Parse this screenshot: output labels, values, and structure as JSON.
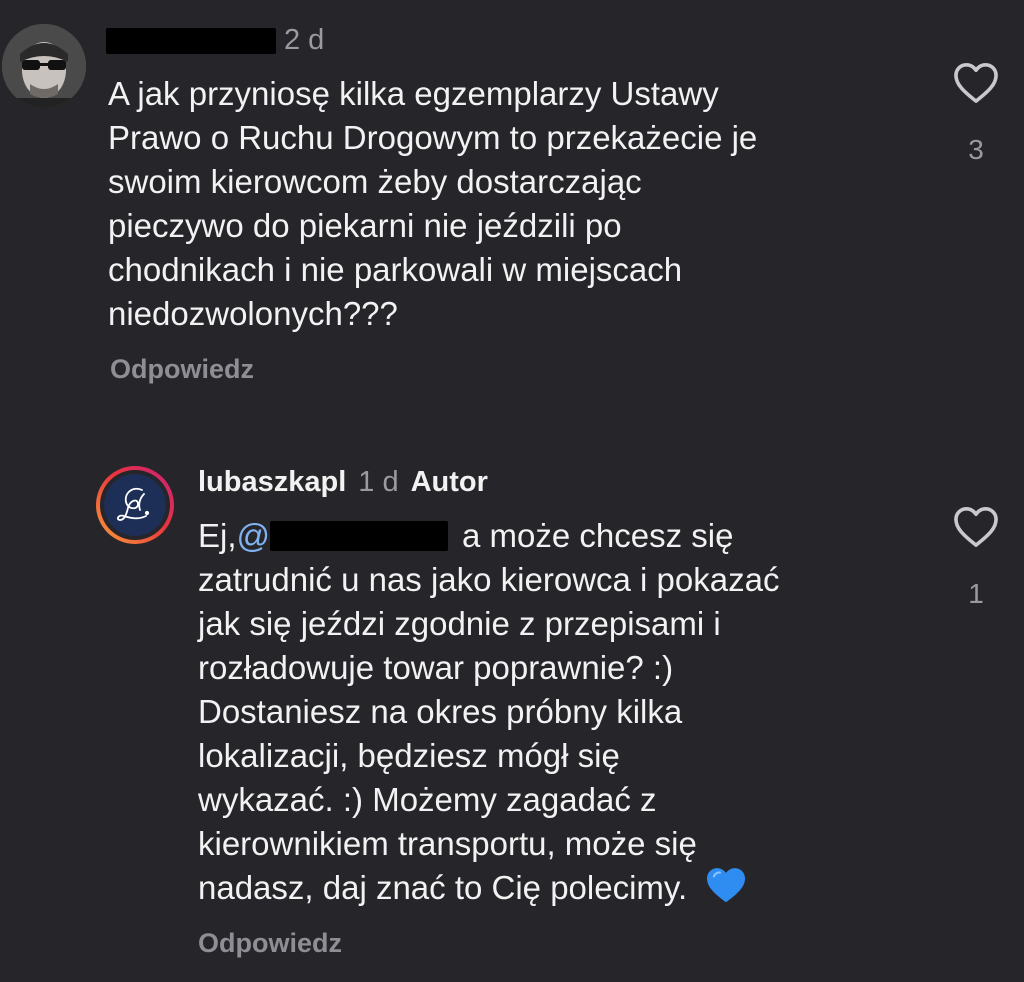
{
  "comments": [
    {
      "time": "2 d",
      "lines": [
        "A jak przyniosę kilka egzemplarzy Ustawy",
        "Prawo o Ruchu Drogowym to przekażecie je",
        "swoim kierowcom żeby dostarczając",
        "pieczywo do piekarni nie jeździli po",
        "chodnikach i nie parkowali w miejscach",
        "niedozwolonych???"
      ],
      "like_count": "3",
      "reply_label": "Odpowiedz"
    },
    {
      "username": "lubaszkapl",
      "time": "1 d",
      "author_badge": "Autor",
      "first_line_prefix": "Ej,",
      "mention_at": "@",
      "first_line_suffix": "a może chcesz się",
      "lines": [
        "zatrudnić u nas jako kierowca i pokazać",
        "jak się jeździ zgodnie z przepisami i",
        "rozładowuje towar poprawnie? :)",
        "Dostaniesz na okres próbny kilka",
        "lokalizacji, będziesz mógł się",
        "wykazać. :) Możemy zagadać z",
        "kierownikiem transportu, może się"
      ],
      "last_line": "nadasz, daj znać to Cię polecimy.",
      "emoji": "blue-heart-emoji",
      "like_count": "1",
      "reply_label": "Odpowiedz"
    }
  ],
  "icons": {
    "like": "heart-outline-icon",
    "avatar_logo": "cursive-l-logo"
  },
  "colors": {
    "background": "#25252a",
    "text": "#f2f2f2",
    "muted": "#8e8e94",
    "mention": "#7fb2f0",
    "story_ring_start": "#f9a13a",
    "story_ring_end": "#c91f7e",
    "logo_bg": "#1d2f57",
    "emoji_blue": "#2f8cf0"
  }
}
